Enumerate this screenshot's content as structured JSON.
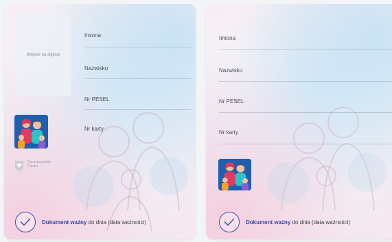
{
  "left_card": {
    "photo_placeholder": "Miejsce na zdjęcie",
    "fields": [
      "Imiona",
      "Nazwisko",
      "Nr PESEL",
      "Nr karty"
    ],
    "emblem_lines": [
      "Rzeczpospolita",
      "Polska"
    ],
    "validity": {
      "strong": "Dokument ważny",
      "rest": " do dnia (data ważności)"
    }
  },
  "right_card": {
    "fields": [
      "Imiona",
      "Nazwisko",
      "Nr PESEL",
      "Nr karty"
    ],
    "validity": {
      "strong": "Dokument ważny",
      "rest": " do dnia (data ważności)"
    }
  },
  "colors": {
    "accent": "#3147a8",
    "family_icon_bg": "#1e5fb0"
  }
}
